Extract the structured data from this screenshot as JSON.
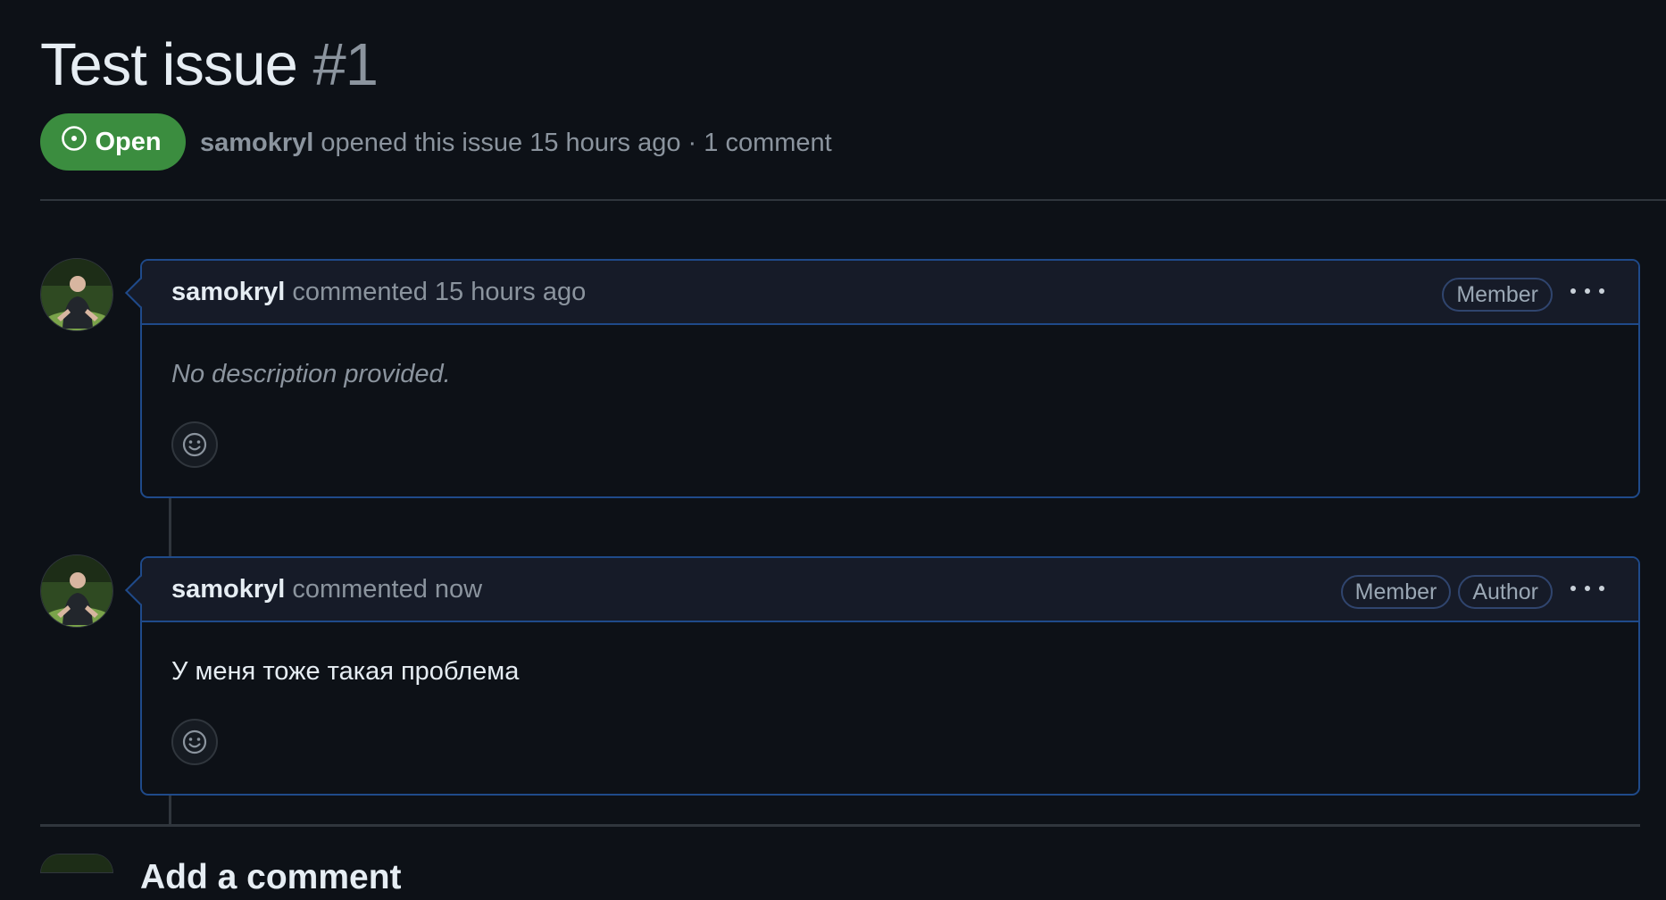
{
  "issue": {
    "title": "Test issue",
    "number": "#1",
    "state": "Open",
    "meta_author": "samokryl",
    "meta_text": "opened this issue 15 hours ago · 1 comment"
  },
  "comments": [
    {
      "author": "samokryl",
      "action_time": "commented 15 hours ago",
      "badges": [
        "Member"
      ],
      "body": "No description provided."
    },
    {
      "author": "samokryl",
      "action_time": "commented now",
      "badges": [
        "Member",
        "Author"
      ],
      "body": "У меня тоже такая проблема"
    }
  ],
  "add_comment": {
    "title": "Add a comment"
  },
  "colors": {
    "open_green": "#3b8d3f",
    "comment_border": "#1f4a8a",
    "background": "#0d1117"
  }
}
